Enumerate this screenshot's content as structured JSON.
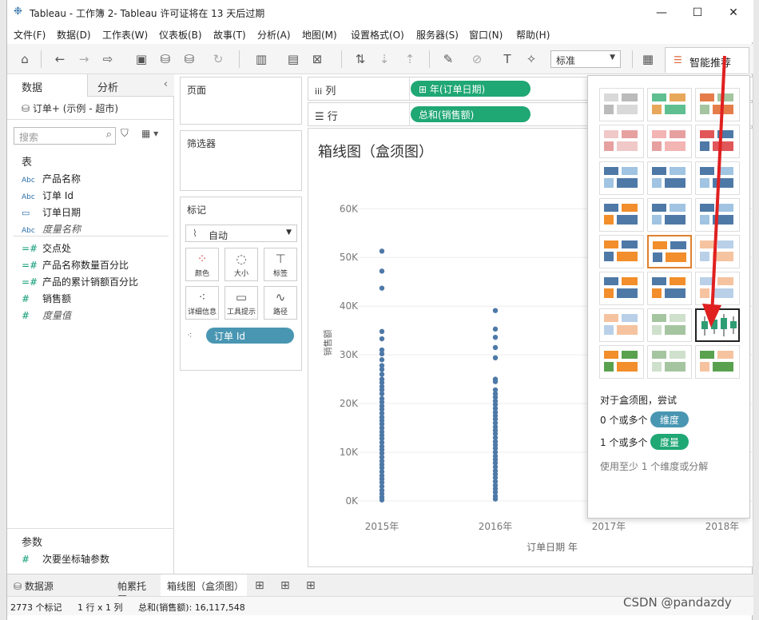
{
  "window": {
    "title": "Tableau - 工作簿 2- Tableau 许可证将在 13 天后过期"
  },
  "menu": [
    "文件(F)",
    "数据(D)",
    "工作表(W)",
    "仪表板(B)",
    "故事(T)",
    "分析(A)",
    "地图(M)",
    "设置格式(O)",
    "服务器(S)",
    "窗口(N)",
    "帮助(H)"
  ],
  "toolbar": {
    "fit_select": "标准",
    "show_me_label": "智能推荐"
  },
  "data_pane": {
    "tab_data": "数据",
    "tab_analytics": "分析",
    "datasource": "订单+ (示例 - 超市)",
    "search_placeholder": "搜索",
    "section_table": "表",
    "dimensions": [
      {
        "type": "Abc",
        "label": "产品名称"
      },
      {
        "type": "Abc",
        "label": "订单 Id"
      },
      {
        "type": "date",
        "label": "订单日期"
      },
      {
        "type": "Abc",
        "label": "度量名称"
      }
    ],
    "measures": [
      "交点处",
      "产品名称数量百分比",
      "产品的累计销额百分比",
      "销售额",
      "度量值"
    ],
    "section_params": "参数",
    "params": [
      "次要坐标轴参数"
    ]
  },
  "shelves": {
    "pages": "页面",
    "filters": "筛选器",
    "marks": "标记",
    "mark_type": "自动",
    "mark_buttons": [
      "颜色",
      "大小",
      "标签",
      "详细信息",
      "工具提示",
      "路径"
    ],
    "mark_pill": "订单 Id",
    "columns_label": "列",
    "columns_pill": "年(订单日期)",
    "rows_label": "行",
    "rows_pill": "总和(销售额)"
  },
  "view": {
    "title": "箱线图（盒须图）"
  },
  "chart_data": {
    "type": "scatter",
    "title": "箱线图（盒须图）",
    "xlabel": "订单日期 年",
    "ylabel": "销售额",
    "categories": [
      "2015年",
      "2016年",
      "2017年",
      "2018年"
    ],
    "yticks": [
      "0K",
      "10K",
      "20K",
      "30K",
      "40K",
      "50K",
      "60K"
    ],
    "ylim": [
      0,
      63000
    ],
    "series": [
      {
        "category": "2015年",
        "values": [
          51300,
          47200,
          43700,
          34800,
          33300,
          31000,
          30200,
          29000,
          27800,
          27000,
          26000,
          25000,
          24300,
          23500,
          22800,
          22000,
          21000,
          20300,
          19500,
          18800,
          18000,
          17200,
          16500,
          15800,
          15000,
          14200,
          13500,
          12800,
          12000,
          11200,
          10500,
          9800,
          9000,
          8200,
          7500,
          6800,
          6000,
          5200,
          4500,
          3800,
          3000,
          2200,
          1500,
          800,
          200
        ]
      },
      {
        "category": "2016年",
        "values": [
          39100,
          35300,
          33600,
          31500,
          29400,
          25000,
          24500,
          22800,
          22000,
          21300,
          20500,
          19800,
          19000,
          18200,
          17500,
          16800,
          16000,
          15200,
          14500,
          13800,
          13000,
          12200,
          11500,
          10800,
          10000,
          9200,
          8500,
          7800,
          7000,
          6200,
          5500,
          4800,
          4000,
          3200,
          2500,
          1800,
          1000,
          400
        ]
      }
    ],
    "color": "#4e79a7"
  },
  "show_me": {
    "hint_title": "对于盒须图，尝试",
    "hint_dim": "0 个或多个",
    "hint_dim_pill": "维度",
    "hint_mea": "1 个或多个",
    "hint_mea_pill": "度量",
    "hint_note": "使用至少 1 个维度或分解"
  },
  "sheet_tabs": [
    "数据源",
    "帕累托图",
    "箱线图（盒须图）"
  ],
  "status": {
    "marks": "2773 个标记",
    "rc": "1 行 x 1 列",
    "sum": "总和(销售额): 16,117,548"
  },
  "watermark": "CSDN @pandazdy"
}
